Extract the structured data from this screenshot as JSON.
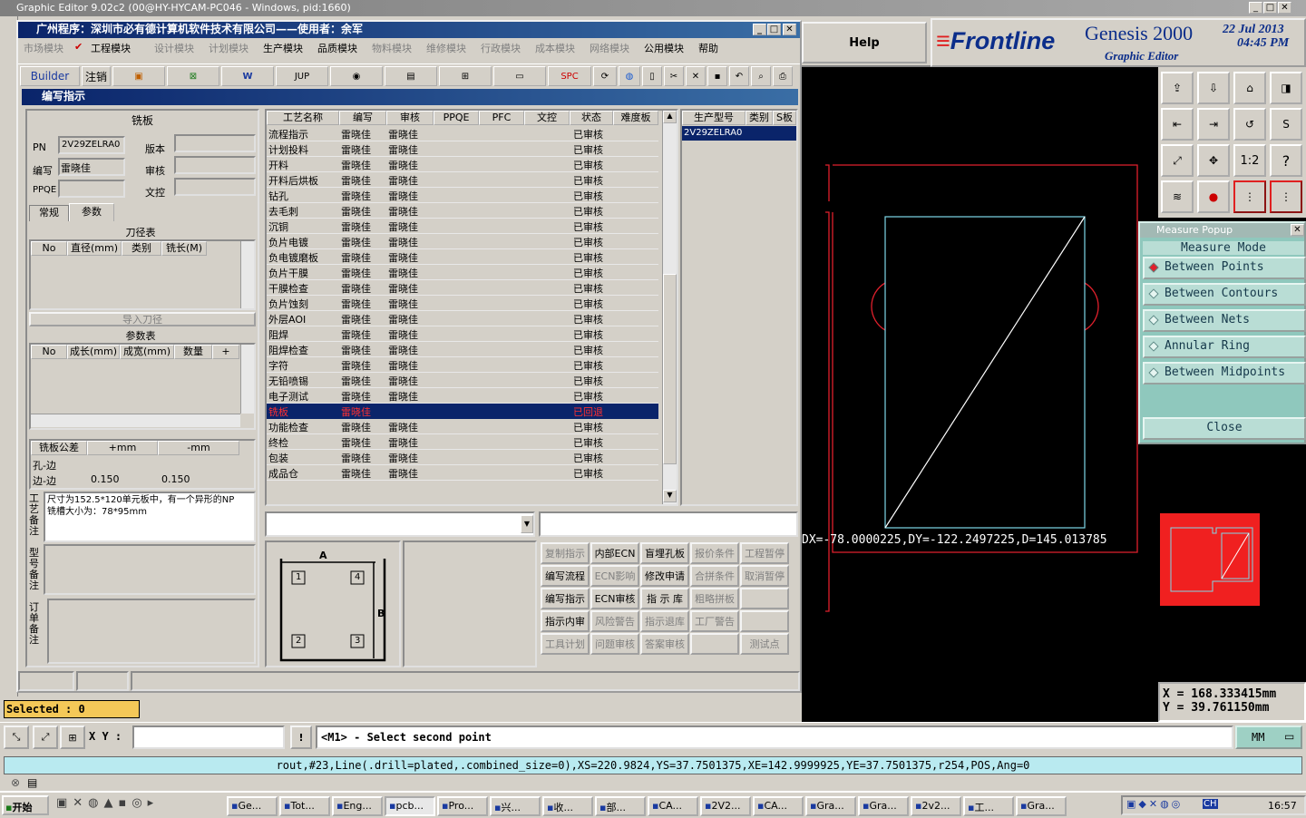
{
  "os_title": "Graphic Editor 9.02c2 (00@HY-HYCAM-PC046 - Windows, pid:1660)",
  "help_label": "Help",
  "brand": {
    "logo": "Frontline",
    "product": "Genesis 2000",
    "subtitle": "Graphic Editor",
    "date": "22 Jul 2013",
    "time": "04:45 PM"
  },
  "app_window": {
    "title": "广州程序：深圳市必有德计算机软件技术有限公司——使用者：余军",
    "menu": [
      "市场模块",
      "工程模块",
      "设计模块",
      "计划模块",
      "生产模块",
      "品质模块",
      "物料模块",
      "维修模块",
      "行政模块",
      "成本模块",
      "网络模块",
      "公用模块",
      "帮助"
    ],
    "toolbar": {
      "builder": "Builder",
      "logout": "注销",
      "jup": "JUP",
      "spc": "SPC"
    }
  },
  "dialog": {
    "title": "编写指示",
    "panel_title": "铣板",
    "fields": {
      "pn_label": "PN",
      "pn_value": "2V29ZELRA0",
      "version_label": "版本",
      "writer_label": "编写",
      "writer_value": "雷晓佳",
      "audit_label": "审核",
      "ppqe_label": "PPQE",
      "doc_label": "文控"
    },
    "tabs": [
      "常规",
      "参数"
    ],
    "tool_table": {
      "title": "刀径表",
      "headers": [
        "No",
        "直径(mm)",
        "类别",
        "铣长(M)"
      ],
      "import_btn": "导入刀径"
    },
    "param_table": {
      "title": "参数表",
      "headers": [
        "No",
        "成长(mm)",
        "成宽(mm)",
        "数量",
        "+"
      ]
    },
    "tolerance": {
      "headers": [
        "铣板公差",
        "+mm",
        "-mm"
      ],
      "rows": [
        [
          "孔-边",
          "",
          ""
        ],
        [
          "边-边",
          "0.150",
          "0.150"
        ]
      ]
    },
    "process_note_label": "工艺备注",
    "process_note_text": "尺寸为152.5*120单元板中，有一个异形的NP铣槽大小为：78*95mm",
    "model_note_label": "型号备注",
    "order_note_label": "订单备注",
    "process_headers": [
      "工艺名称",
      "编写",
      "审核",
      "PPQE",
      "PFC",
      "文控",
      "状态",
      "难度板"
    ],
    "process_rows": [
      [
        "流程指示",
        "雷晓佳",
        "雷晓佳",
        "已审核"
      ],
      [
        "计划投料",
        "雷晓佳",
        "雷晓佳",
        "已审核"
      ],
      [
        "开料",
        "雷晓佳",
        "雷晓佳",
        "已审核"
      ],
      [
        "开料后烘板",
        "雷晓佳",
        "雷晓佳",
        "已审核"
      ],
      [
        "钻孔",
        "雷晓佳",
        "雷晓佳",
        "已审核"
      ],
      [
        "去毛刺",
        "雷晓佳",
        "雷晓佳",
        "已审核"
      ],
      [
        "沉铜",
        "雷晓佳",
        "雷晓佳",
        "已审核"
      ],
      [
        "负片电镀",
        "雷晓佳",
        "雷晓佳",
        "已审核"
      ],
      [
        "负电镀磨板",
        "雷晓佳",
        "雷晓佳",
        "已审核"
      ],
      [
        "负片干膜",
        "雷晓佳",
        "雷晓佳",
        "已审核"
      ],
      [
        "干膜检查",
        "雷晓佳",
        "雷晓佳",
        "已审核"
      ],
      [
        "负片蚀刻",
        "雷晓佳",
        "雷晓佳",
        "已审核"
      ],
      [
        "外层AOI",
        "雷晓佳",
        "雷晓佳",
        "已审核"
      ],
      [
        "阻焊",
        "雷晓佳",
        "雷晓佳",
        "已审核"
      ],
      [
        "阻焊检查",
        "雷晓佳",
        "雷晓佳",
        "已审核"
      ],
      [
        "字符",
        "雷晓佳",
        "雷晓佳",
        "已审核"
      ],
      [
        "无铅喷锡",
        "雷晓佳",
        "雷晓佳",
        "已审核"
      ],
      [
        "电子测试",
        "雷晓佳",
        "雷晓佳",
        "已审核"
      ],
      [
        "铣板",
        "雷晓佳",
        "",
        "已回退"
      ],
      [
        "功能检查",
        "雷晓佳",
        "雷晓佳",
        "已审核"
      ],
      [
        "终检",
        "雷晓佳",
        "雷晓佳",
        "已审核"
      ],
      [
        "包装",
        "雷晓佳",
        "雷晓佳",
        "已审核"
      ],
      [
        "成品仓",
        "雷晓佳",
        "雷晓佳",
        "已审核"
      ]
    ],
    "prod_headers": [
      "生产型号",
      "类别",
      "S板"
    ],
    "prod_row": "2V29ZELRA0",
    "diagram": {
      "a": "A",
      "b": "B",
      "n1": "1",
      "n2": "2",
      "n3": "3",
      "n4": "4"
    },
    "action_buttons": [
      [
        "复制指示",
        "内部ECN",
        "盲埋孔板",
        "报价条件",
        "工程暂停"
      ],
      [
        "编写流程",
        "ECN影响",
        "修改申请",
        "合拼条件",
        "取消暂停"
      ],
      [
        "编写指示",
        "ECN审核",
        "指 示 库",
        "粗略拼板",
        ""
      ],
      [
        "指示内审",
        "风险警告",
        "指示退库",
        "工厂警告",
        ""
      ],
      [
        "工具计划",
        "问题审核",
        "答案审核",
        "",
        "测试点"
      ]
    ]
  },
  "canvas": {
    "measure_readout": "DX=-78.0000225,DY=-122.2497225,D=145.013785"
  },
  "measure_popup": {
    "title": "Measure Popup",
    "mode_label": "Measure Mode",
    "options": [
      "Between Points",
      "Between Contours",
      "Between Nets",
      "Annular Ring",
      "Between Midpoints"
    ],
    "selected": "Between Points",
    "close_label": "Close"
  },
  "coords": {
    "x": "X  =  168.333415mm",
    "y": "Y  =  39.761150mm"
  },
  "status": {
    "selected": "Selected : 0",
    "xy_label": "X Y :",
    "xy_value": "",
    "prompt": "<M1> - Select second point",
    "units": "MM",
    "feature_info": "rout,#23,Line(.drill=plated,.combined_size=0),XS=220.9824,YS=37.7501375,XE=142.9999925,YE=37.7501375,r254,POS,Ang=0"
  },
  "taskbar": {
    "start": "开始",
    "tasks": [
      "Ge...",
      "Tot...",
      "Eng...",
      "pcb...",
      "Pro...",
      "兴...",
      "收...",
      "部...",
      "CA...",
      "2V2...",
      "CA...",
      "Gra...",
      "Gra...",
      "2v2...",
      "工...",
      "Gra..."
    ],
    "clock": "16:57",
    "ime": "CH"
  },
  "colors": {
    "title_blue": "#0a246a",
    "canvas_bg": "#000000",
    "outline_red": "#e0202c",
    "profile_cyan": "#7fd8e8",
    "popup_bg": "#8fc8bd",
    "selection_red": "#ff2020"
  }
}
